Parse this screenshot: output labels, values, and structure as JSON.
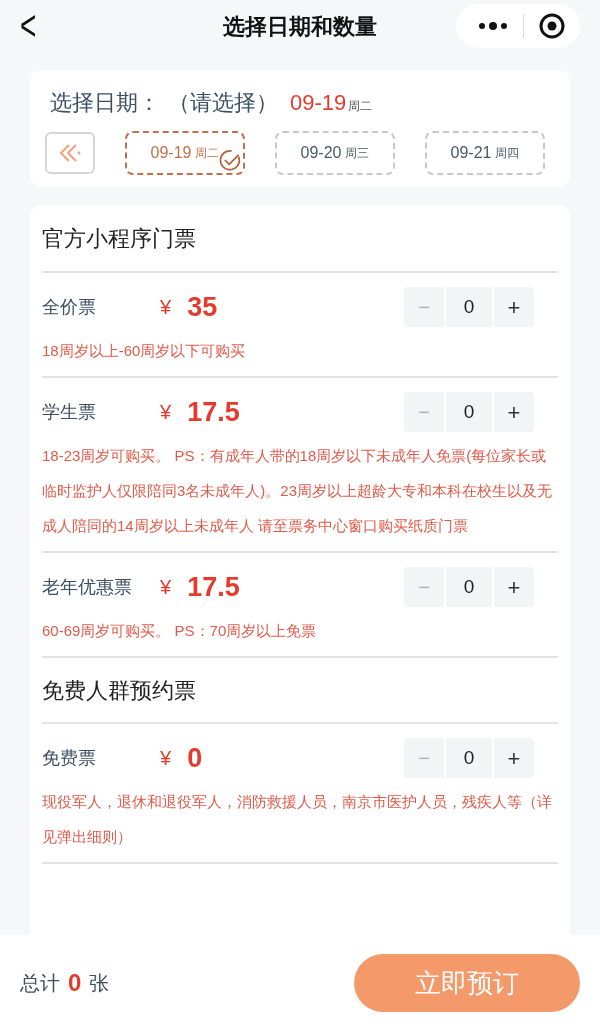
{
  "header": {
    "back": "<",
    "title": "选择日期和数量"
  },
  "date_picker": {
    "label": "选择日期：",
    "hint": "（请选择）",
    "selected_date": "09-19",
    "selected_weekday": "周二",
    "dates": [
      {
        "date": "09-19",
        "weekday": "周二",
        "selected": true
      },
      {
        "date": "09-20",
        "weekday": "周三",
        "selected": false
      },
      {
        "date": "09-21",
        "weekday": "周四",
        "selected": false
      }
    ]
  },
  "sections": [
    {
      "title": "官方小程序门票",
      "tickets": [
        {
          "name": "全价票",
          "currency": "¥",
          "price": "35",
          "minus": "−",
          "quantity": "0",
          "plus": "+",
          "minus_disabled": true,
          "note": "18周岁以上-60周岁以下可购买"
        },
        {
          "name": "学生票",
          "currency": "¥",
          "price": "17.5",
          "minus": "−",
          "quantity": "0",
          "plus": "+",
          "minus_disabled": true,
          "note": "18-23周岁可购买。 PS：有成年人带的18周岁以下未成年人免票(每位家长或临时监护人仅限陪同3名未成年人)。23周岁以上超龄大专和本科在校生以及无成人陪同的14周岁以上未成年人 请至票务中心窗口购买纸质门票"
        },
        {
          "name": "老年优惠票",
          "currency": "¥",
          "price": "17.5",
          "minus": "−",
          "quantity": "0",
          "plus": "+",
          "minus_disabled": true,
          "note": "60-69周岁可购买。 PS：70周岁以上免票"
        }
      ]
    },
    {
      "title": "免费人群预约票",
      "tickets": [
        {
          "name": "免费票",
          "currency": "¥",
          "price": "0",
          "minus": "−",
          "quantity": "0",
          "plus": "+",
          "minus_disabled": true,
          "note": "现役军人，退休和退役军人，消防救援人员，南京市医护人员，残疾人等（详见弹出细则）"
        }
      ]
    }
  ],
  "footer": {
    "total_label": "总计",
    "total": "0",
    "unit": "张",
    "button": "立即预订"
  }
}
